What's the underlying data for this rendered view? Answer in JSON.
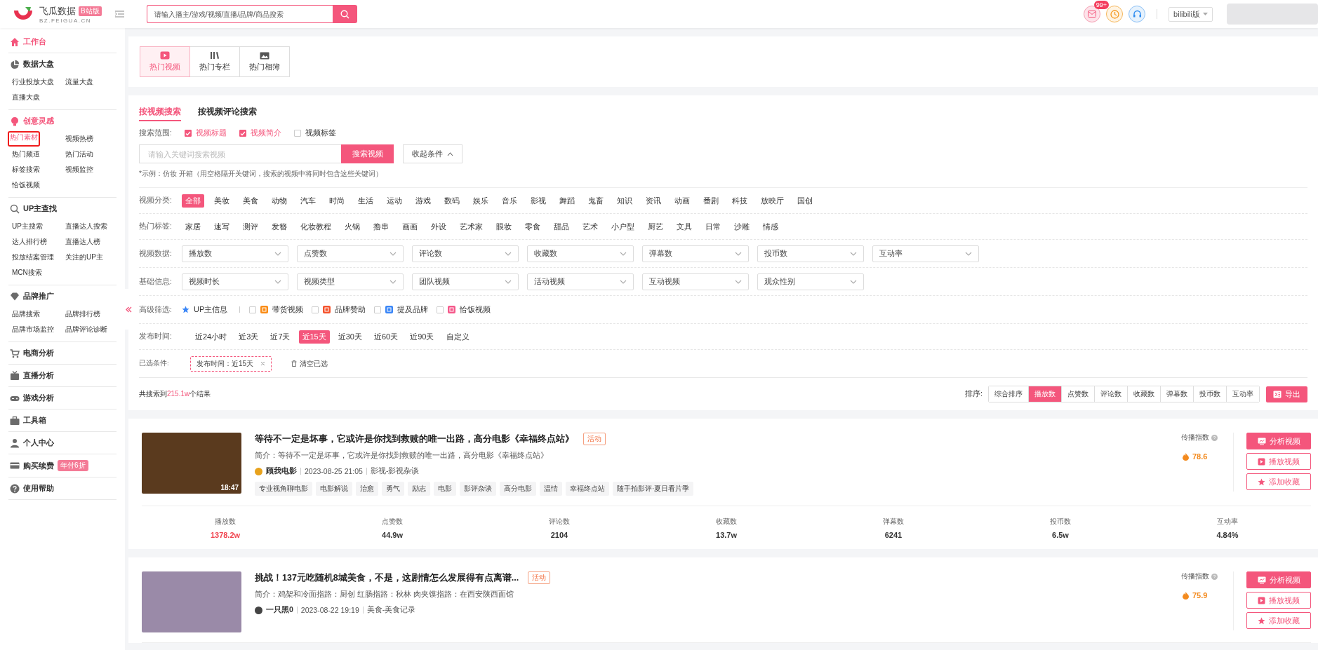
{
  "header": {
    "logo_name": "飞瓜数据",
    "logo_badge": "B站版",
    "logo_domain": "BZ.FEIGUA.CN",
    "search_placeholder": "请输入播主/游戏/视频/直播/品牌/商品搜索",
    "message_badge": "99+",
    "platform": "bilibili版"
  },
  "sidebar": {
    "sections": [
      {
        "title": "工作台",
        "kind": "home",
        "selected": true
      },
      {
        "title": "数据大盘",
        "kind": "pie",
        "selected": false,
        "items": [
          {
            "label": "行业投放大盘",
            "selected": false
          },
          {
            "label": "流量大盘",
            "selected": false
          },
          {
            "label": "直播大盘",
            "selected": false
          }
        ]
      },
      {
        "title": "创意灵感",
        "kind": "bulb",
        "selected": true,
        "items": [
          {
            "label": "热门素材",
            "selected": true
          },
          {
            "label": "视频热榜",
            "selected": false
          },
          {
            "label": "热门频道",
            "selected": false
          },
          {
            "label": "热门活动",
            "selected": false
          },
          {
            "label": "标签搜索",
            "selected": false
          },
          {
            "label": "视频监控",
            "selected": false
          },
          {
            "label": "恰饭视频",
            "selected": false
          }
        ]
      },
      {
        "title": "UP主查找",
        "kind": "search",
        "selected": false,
        "items": [
          {
            "label": "UP主搜索",
            "selected": false
          },
          {
            "label": "直播达人搜索",
            "selected": false
          },
          {
            "label": "达人排行榜",
            "selected": false
          },
          {
            "label": "直播达人榜",
            "selected": false
          },
          {
            "label": "投放结案管理",
            "selected": false
          },
          {
            "label": "关注的UP主",
            "selected": false
          },
          {
            "label": "MCN搜索",
            "selected": false
          }
        ]
      },
      {
        "title": "品牌推广",
        "kind": "diamond",
        "selected": false,
        "items": [
          {
            "label": "品牌搜索",
            "selected": false
          },
          {
            "label": "品牌排行榜",
            "selected": false
          },
          {
            "label": "品牌市场监控",
            "selected": false
          },
          {
            "label": "品牌评论诊断",
            "selected": false
          }
        ]
      },
      {
        "title": "电商分析",
        "kind": "cart",
        "selected": false
      },
      {
        "title": "直播分析",
        "kind": "tv",
        "selected": false
      },
      {
        "title": "游戏分析",
        "kind": "gamepad",
        "selected": false
      },
      {
        "title": "工具箱",
        "kind": "briefcase",
        "selected": false
      },
      {
        "title": "个人中心",
        "kind": "person",
        "selected": false
      },
      {
        "title": "购买续费",
        "kind": "card",
        "selected": false,
        "badge": "年付6折"
      },
      {
        "title": "使用帮助",
        "kind": "help",
        "selected": false
      }
    ]
  },
  "content_tabs": [
    {
      "label": "热门视频",
      "kind": "video",
      "selected": true
    },
    {
      "label": "热门专栏",
      "kind": "column",
      "selected": false
    },
    {
      "label": "热门相簿",
      "kind": "album",
      "selected": false
    }
  ],
  "search": {
    "tabs": [
      {
        "label": "按视频搜索",
        "selected": true
      },
      {
        "label": "按视频评论搜索",
        "selected": false
      }
    ],
    "scope_label": "搜索范围:",
    "scope": [
      {
        "label": "视频标题",
        "checked": true
      },
      {
        "label": "视频简介",
        "checked": true
      },
      {
        "label": "视频标签",
        "checked": false
      }
    ],
    "placeholder": "请输入关键词搜索视频",
    "button": "搜索视频",
    "collapse": "收起条件",
    "hint": "*示例：仿妆 开箱（用空格隔开关键词，搜索的视频中将同时包含这些关键词）"
  },
  "filter_rows": [
    {
      "kind": "chips",
      "label": "视频分类:",
      "options": [
        {
          "label": "全部",
          "selected": true
        },
        {
          "label": "美妆",
          "selected": false
        },
        {
          "label": "美食",
          "selected": false
        },
        {
          "label": "动物",
          "selected": false
        },
        {
          "label": "汽车",
          "selected": false
        },
        {
          "label": "时尚",
          "selected": false
        },
        {
          "label": "生活",
          "selected": false
        },
        {
          "label": "运动",
          "selected": false
        },
        {
          "label": "游戏",
          "selected": false
        },
        {
          "label": "数码",
          "selected": false
        },
        {
          "label": "娱乐",
          "selected": false
        },
        {
          "label": "音乐",
          "selected": false
        },
        {
          "label": "影视",
          "selected": false
        },
        {
          "label": "舞蹈",
          "selected": false
        },
        {
          "label": "鬼畜",
          "selected": false
        },
        {
          "label": "知识",
          "selected": false
        },
        {
          "label": "资讯",
          "selected": false
        },
        {
          "label": "动画",
          "selected": false
        },
        {
          "label": "番剧",
          "selected": false
        },
        {
          "label": "科技",
          "selected": false
        },
        {
          "label": "放映厅",
          "selected": false
        },
        {
          "label": "国创",
          "selected": false
        }
      ]
    },
    {
      "kind": "chips",
      "label": "热门标签:",
      "options": [
        {
          "label": "家居",
          "selected": false
        },
        {
          "label": "速写",
          "selected": false
        },
        {
          "label": "测评",
          "selected": false
        },
        {
          "label": "发簪",
          "selected": false
        },
        {
          "label": "化妆教程",
          "selected": false
        },
        {
          "label": "火锅",
          "selected": false
        },
        {
          "label": "撸串",
          "selected": false
        },
        {
          "label": "画画",
          "selected": false
        },
        {
          "label": "外设",
          "selected": false
        },
        {
          "label": "艺术家",
          "selected": false
        },
        {
          "label": "眼妆",
          "selected": false
        },
        {
          "label": "零食",
          "selected": false
        },
        {
          "label": "甜品",
          "selected": false
        },
        {
          "label": "艺术",
          "selected": false
        },
        {
          "label": "小户型",
          "selected": false
        },
        {
          "label": "厨艺",
          "selected": false
        },
        {
          "label": "文具",
          "selected": false
        },
        {
          "label": "日常",
          "selected": false
        },
        {
          "label": "沙雕",
          "selected": false
        },
        {
          "label": "情感",
          "selected": false
        }
      ]
    },
    {
      "kind": "dropdowns",
      "label": "视频数据:",
      "options": [
        {
          "label": "播放数"
        },
        {
          "label": "点赞数"
        },
        {
          "label": "评论数"
        },
        {
          "label": "收藏数"
        },
        {
          "label": "弹幕数"
        },
        {
          "label": "投币数"
        },
        {
          "label": "互动率"
        }
      ]
    },
    {
      "kind": "dropdowns",
      "label": "基础信息:",
      "options": [
        {
          "label": "视频时长"
        },
        {
          "label": "视频类型"
        },
        {
          "label": "团队视频"
        },
        {
          "label": "活动视频"
        },
        {
          "label": "互动视频"
        },
        {
          "label": "观众性别"
        }
      ]
    },
    {
      "kind": "checks",
      "label": "高级筛选:",
      "options": [
        {
          "kind": "info",
          "label": "UP主信息"
        },
        {
          "kind": "check",
          "label": "带货视频",
          "checked": false,
          "color": "#fa8c16"
        },
        {
          "kind": "check",
          "label": "品牌赞助",
          "checked": false,
          "color": "#f5532d"
        },
        {
          "kind": "check",
          "label": "提及品牌",
          "checked": false,
          "color": "#3a86f7"
        },
        {
          "kind": "check",
          "label": "恰饭视频",
          "checked": false,
          "color": "#f5588a"
        }
      ]
    },
    {
      "kind": "chips",
      "label": "发布时间:",
      "options": [
        {
          "label": "近24小时",
          "selected": false
        },
        {
          "label": "近3天",
          "selected": false
        },
        {
          "label": "近7天",
          "selected": false
        },
        {
          "label": "近15天",
          "selected": true
        },
        {
          "label": "近30天",
          "selected": false
        },
        {
          "label": "近60天",
          "selected": false
        },
        {
          "label": "近90天",
          "selected": false
        },
        {
          "label": "自定义",
          "selected": false
        }
      ]
    }
  ],
  "selected_conditions": {
    "label": "已选条件:",
    "chips": [
      "发布时间：近15天"
    ],
    "clear": "清空已选"
  },
  "results": {
    "count_prefix": "共搜索到",
    "count": "215.1w",
    "count_suffix": "个结果",
    "sort_label": "排序:",
    "sort_options": [
      {
        "label": "综合排序",
        "selected": false
      },
      {
        "label": "播放数",
        "selected": true
      },
      {
        "label": "点赞数",
        "selected": false
      },
      {
        "label": "评论数",
        "selected": false
      },
      {
        "label": "收藏数",
        "selected": false
      },
      {
        "label": "弹幕数",
        "selected": false
      },
      {
        "label": "投币数",
        "selected": false
      },
      {
        "label": "互动率",
        "selected": false
      }
    ],
    "export": "导出"
  },
  "videos": [
    {
      "title": "等待不一定是坏事，它或许是你找到救赎的唯一出路，高分电影《幸福终点站》",
      "badge": "活动",
      "intro": "简介：等待不一定是坏事，它或许是你找到救赎的唯一出路，高分电影《幸福终点站》",
      "author": "顾我电影",
      "time": "2023-08-25 21:05",
      "category": "影视-影视杂谈",
      "duration": "18:47",
      "tags": [
        "专业视角聊电影",
        "电影解说",
        "治愈",
        "勇气",
        "励志",
        "电影",
        "影评杂谈",
        "高分电影",
        "温情",
        "幸福终点站",
        "随手拍影评·夏日看片季"
      ],
      "index_label": "传播指数",
      "index_value": "78.6",
      "actions": [
        {
          "label": "分析视频",
          "kind": "analyze"
        },
        {
          "label": "播放视频",
          "kind": "play"
        },
        {
          "label": "添加收藏",
          "kind": "favorite"
        }
      ],
      "stats": [
        {
          "label": "播放数",
          "value": "1378.2w",
          "highlighted": true
        },
        {
          "label": "点赞数",
          "value": "44.9w",
          "highlighted": false
        },
        {
          "label": "评论数",
          "value": "2104",
          "highlighted": false
        },
        {
          "label": "收藏数",
          "value": "13.7w",
          "highlighted": false
        },
        {
          "label": "弹幕数",
          "value": "6241",
          "highlighted": false
        },
        {
          "label": "投币数",
          "value": "6.5w",
          "highlighted": false
        },
        {
          "label": "互动率",
          "value": "4.84%",
          "highlighted": false
        }
      ]
    },
    {
      "title": "挑战！137元吃随机8城美食，不是，这剧情怎么发展得有点离谱...",
      "badge": "活动",
      "intro": "简介：鸡架和冷面指路：厨创 红肠指路：秋林 肉夹馍指路：在西安陕西面馆",
      "author": "一只黑0",
      "time": "2023-08-22 19:19",
      "category": "美食-美食记录",
      "index_label": "传播指数",
      "index_value": "75.9",
      "actions": [
        {
          "label": "分析视频",
          "kind": "analyze"
        },
        {
          "label": "播放视频",
          "kind": "play"
        },
        {
          "label": "添加收藏",
          "kind": "favorite"
        }
      ]
    }
  ]
}
